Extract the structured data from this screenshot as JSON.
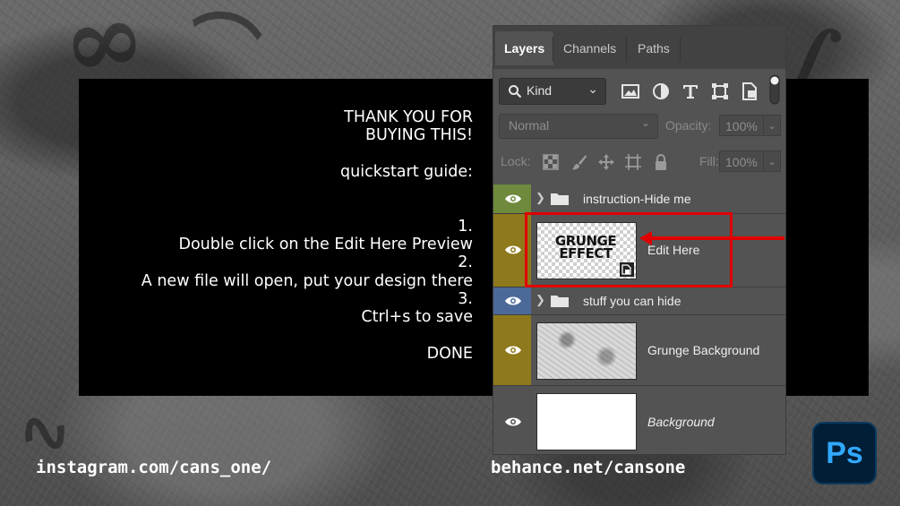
{
  "guide": {
    "lines": [
      "THANK YOU FOR",
      "BUYING THIS!",
      "",
      "quickstart guide:",
      "",
      "",
      "1.",
      "Double click on the Edit Here Preview",
      "2.",
      "A new file will open, put your design there",
      "3.",
      "Ctrl+s to save",
      "",
      "DONE"
    ]
  },
  "panel": {
    "tabs": [
      "Layers",
      "Channels",
      "Paths"
    ],
    "active_tab": "Layers",
    "filter": {
      "kind_label": "Kind",
      "icons": [
        "image-filter-icon",
        "adjustment-filter-icon",
        "type-filter-icon",
        "shape-filter-icon",
        "smart-object-filter-icon"
      ]
    },
    "blend_mode": "Normal",
    "opacity_label": "Opacity:",
    "opacity_value": "100%",
    "lock_label": "Lock:",
    "fill_label": "Fill:",
    "fill_value": "100%",
    "layers": [
      {
        "name": "instruction-Hide me",
        "type": "group",
        "eye_color": "#6f8a3c"
      },
      {
        "name": "Edit Here",
        "type": "smart-object",
        "eye_color": "#8e7a1c",
        "thumb_text": "GRUNGE EFFECT"
      },
      {
        "name": "stuff you can hide",
        "type": "group",
        "eye_color": "#4c6a99"
      },
      {
        "name": "Grunge Background",
        "type": "image",
        "eye_color": "#8e7a1c"
      },
      {
        "name": "Background",
        "type": "background",
        "eye_color": "#535353"
      }
    ]
  },
  "footer": {
    "instagram": "instagram.com/cans_one/",
    "behance": "behance.net/cansone"
  },
  "badge": {
    "label": "Ps"
  },
  "colors": {
    "highlight": "#e00000",
    "ps_logo_bg": "#001e36",
    "ps_logo_fg": "#31a8ff"
  }
}
